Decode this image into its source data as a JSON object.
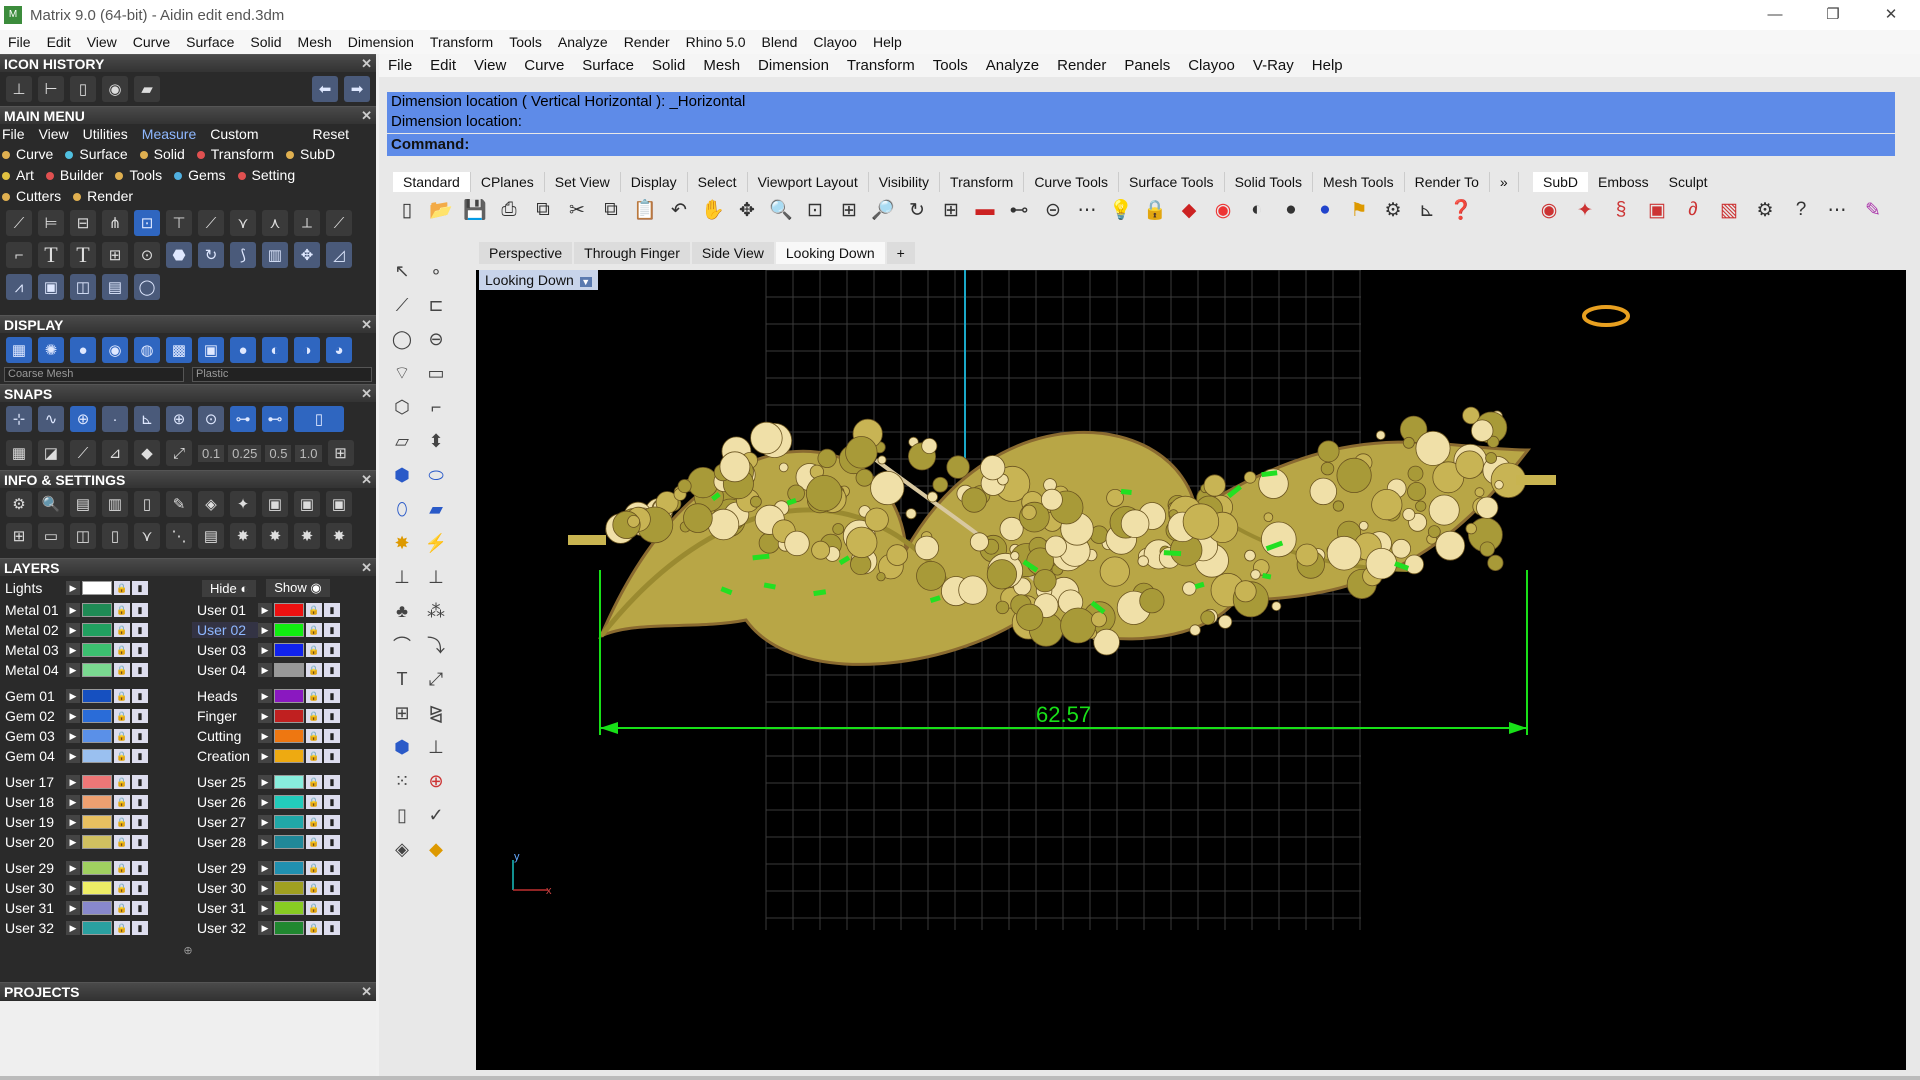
{
  "window": {
    "title": "Matrix 9.0 (64-bit) - Aidin edit end.3dm",
    "app_icon": "matrix-icon"
  },
  "top_menu": [
    "File",
    "Edit",
    "View",
    "Curve",
    "Surface",
    "Solid",
    "Mesh",
    "Dimension",
    "Transform",
    "Tools",
    "Analyze",
    "Render",
    "Rhino 5.0",
    "Blend",
    "Clayoo",
    "Help"
  ],
  "left": {
    "icon_history": "ICON HISTORY",
    "main_menu": "MAIN MENU",
    "main_menu_items": [
      "File",
      "View",
      "Utilities",
      "Measure",
      "Custom"
    ],
    "reset": "Reset",
    "categories": [
      {
        "label": "Curve",
        "color": "#e0b050"
      },
      {
        "label": "Surface",
        "color": "#50c0e0"
      },
      {
        "label": "Solid",
        "color": "#e0b050"
      },
      {
        "label": "Transform",
        "color": "#e05050"
      },
      {
        "label": "SubD",
        "color": "#e0b050"
      },
      {
        "label": "Art",
        "color": "#e0c040"
      },
      {
        "label": "Builder",
        "color": "#e05050"
      },
      {
        "label": "Tools",
        "color": "#e0b050"
      },
      {
        "label": "Gems",
        "color": "#50b0e0"
      },
      {
        "label": "Setting",
        "color": "#e05050"
      },
      {
        "label": "Cutters",
        "color": "#e0b050"
      },
      {
        "label": "Render",
        "color": "#e0b050"
      }
    ],
    "display": "DISPLAY",
    "coarse_mesh": "Coarse Mesh",
    "plastic": "Plastic",
    "snaps": "SNAPS",
    "snap_values": [
      "0.1",
      "0.25",
      "0.5",
      "1.0"
    ],
    "info_settings": "INFO & SETTINGS",
    "layers_title": "LAYERS",
    "lights": "Lights",
    "hide": "Hide",
    "show": "Show",
    "projects": "PROJECTS",
    "layer_groups": [
      [
        {
          "a": "Metal 01",
          "ac": "#1f8a55",
          "b": "User 01",
          "bc": "#ee1111",
          "bsel": false
        },
        {
          "a": "Metal 02",
          "ac": "#21a060",
          "b": "User 02",
          "bc": "#11ee11",
          "bsel": true
        },
        {
          "a": "Metal 03",
          "ac": "#3cc070",
          "b": "User 03",
          "bc": "#1122ee",
          "bsel": false
        },
        {
          "a": "Metal 04",
          "ac": "#7ad890",
          "b": "User 04",
          "bc": "#999999",
          "bsel": false
        }
      ],
      [
        {
          "a": "Gem 01",
          "ac": "#1650c0",
          "b": "Heads",
          "bc": "#8a18c0",
          "bsel": false
        },
        {
          "a": "Gem 02",
          "ac": "#2a6cd8",
          "b": "Finger",
          "bc": "#c02020",
          "bsel": false
        },
        {
          "a": "Gem 03",
          "ac": "#5a90e8",
          "b": "Cutting",
          "bc": "#ee7711",
          "bsel": false
        },
        {
          "a": "Gem 04",
          "ac": "#9ac0f0",
          "b": "Creation",
          "bc": "#eeaa11",
          "bsel": false
        }
      ],
      [
        {
          "a": "User 17",
          "ac": "#ee7777",
          "b": "User 25",
          "bc": "#88eedd",
          "bsel": false
        },
        {
          "a": "User 18",
          "ac": "#eea070",
          "b": "User 26",
          "bc": "#22ccbb",
          "bsel": false
        },
        {
          "a": "User 19",
          "ac": "#e8c060",
          "b": "User 27",
          "bc": "#20a8a8",
          "bsel": false
        },
        {
          "a": "User 20",
          "ac": "#d0c060",
          "b": "User 28",
          "bc": "#208898",
          "bsel": false
        }
      ],
      [
        {
          "a": "User 29",
          "ac": "#a0d060",
          "b": "User 29",
          "bc": "#2090b0",
          "bsel": false
        },
        {
          "a": "User 30",
          "ac": "#eeee66",
          "b": "User 30",
          "bc": "#a0a020",
          "bsel": false
        },
        {
          "a": "User 31",
          "ac": "#8888cc",
          "b": "User 31",
          "bc": "#88cc22",
          "bsel": false
        },
        {
          "a": "User 32",
          "ac": "#2aa0a0",
          "b": "User 32",
          "bc": "#208830",
          "bsel": false
        }
      ]
    ]
  },
  "main": {
    "menu": [
      "File",
      "Edit",
      "View",
      "Curve",
      "Surface",
      "Solid",
      "Mesh",
      "Dimension",
      "Transform",
      "Tools",
      "Analyze",
      "Render",
      "Panels",
      "Clayoo",
      "V-Ray",
      "Help"
    ],
    "cmd_line1": "Dimension location ( Vertical  Horizontal ): _Horizontal",
    "cmd_line2": "Dimension location:",
    "command": "Command:",
    "toolbar_tabs": [
      "Standard",
      "CPlanes",
      "Set View",
      "Display",
      "Select",
      "Viewport Layout",
      "Visibility",
      "Transform",
      "Curve Tools",
      "Surface Tools",
      "Solid Tools",
      "Mesh Tools",
      "Render To"
    ],
    "toolbar_tabs_overflow": "»",
    "right_tabs": [
      "SubD",
      "Emboss",
      "Sculpt"
    ],
    "viewport_tabs": [
      "Perspective",
      "Through Finger",
      "Side View",
      "Looking Down"
    ],
    "add_tab": "+",
    "viewport_label": "Looking Down",
    "dimension_text": "62.57",
    "axis_y": "y",
    "axis_x": "x",
    "colors": {
      "cmd_bg": "#5e8be8",
      "dim": "#18e018",
      "grid": "#3a3a3a",
      "piece": "#c8b050"
    }
  }
}
